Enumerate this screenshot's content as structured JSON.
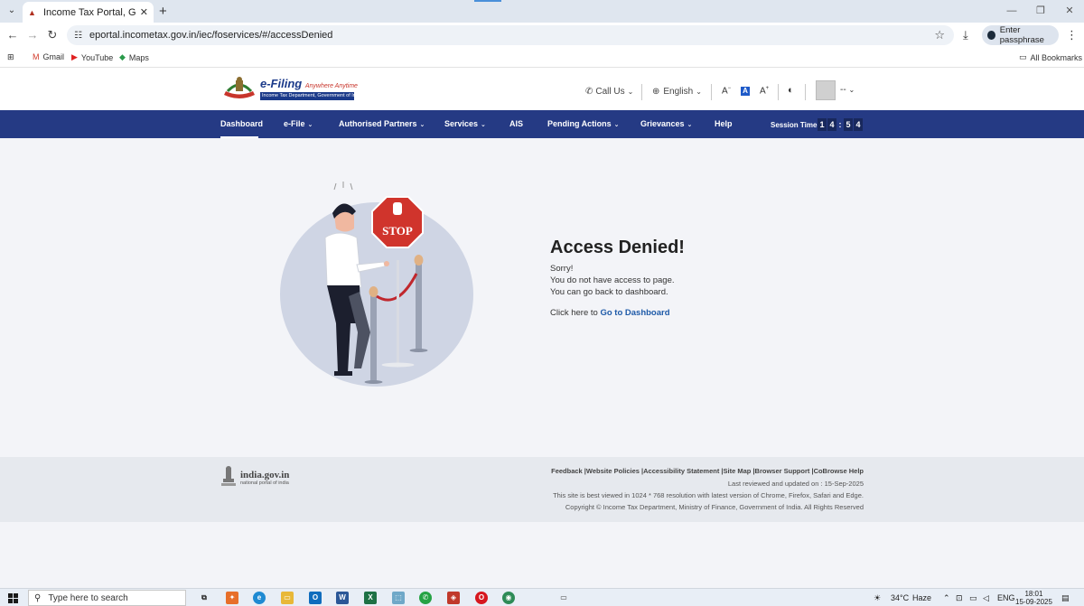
{
  "browser": {
    "tab_title": "Income Tax Portal, Government",
    "url": "eportal.incometax.gov.in/iec/foservices/#/accessDenied",
    "passphrase_label": "Enter passphrase",
    "bookmarks": [
      "Gmail",
      "YouTube",
      "Maps"
    ],
    "all_bookmarks": "All Bookmarks"
  },
  "header": {
    "logo_title": "e-Filing",
    "logo_tagline": "Anywhere Anytime",
    "logo_sub": "Income Tax Department, Government of India",
    "call_us": "Call Us",
    "language": "English",
    "font_decrease": "A",
    "font_normal": "A",
    "font_increase": "A",
    "user_name": "--"
  },
  "nav": {
    "items": [
      "Dashboard",
      "e-File",
      "Authorised Partners",
      "Services",
      "AIS",
      "Pending Actions",
      "Grievances",
      "Help"
    ],
    "session_label": "Session Time",
    "session_digits": [
      "1",
      "4",
      ":",
      "5",
      "4"
    ]
  },
  "main": {
    "stop_sign": "STOP",
    "title": "Access Denied!",
    "line1": "Sorry!",
    "line2": "You do not have access to page.",
    "line3": "You can go back to dashboard.",
    "click_here": "Click here to",
    "dashboard_link": "Go to Dashboard"
  },
  "footer": {
    "gov_title": "india.gov.in",
    "gov_sub": "national portal of india",
    "links": "Feedback |Website Policies |Accessibility Statement |Site Map |Browser Support |CoBrowse Help",
    "last_reviewed": "Last reviewed and updated on : 15-Sep-2025",
    "best_viewed": "This site is best viewed in 1024 * 768 resolution with latest version of Chrome, Firefox, Safari and Edge.",
    "copyright": "Copyright © Income Tax Department, Ministry of Finance, Government of India. All Rights Reserved"
  },
  "taskbar": {
    "search_placeholder": "Type here to search",
    "temperature": "34°C",
    "weather": "Haze",
    "lang": "ENG",
    "time": "18:01",
    "date": "15-09-2025"
  },
  "colors": {
    "nav_bg": "#253a84",
    "link": "#1e5aa8",
    "stop_red": "#d0342c"
  }
}
